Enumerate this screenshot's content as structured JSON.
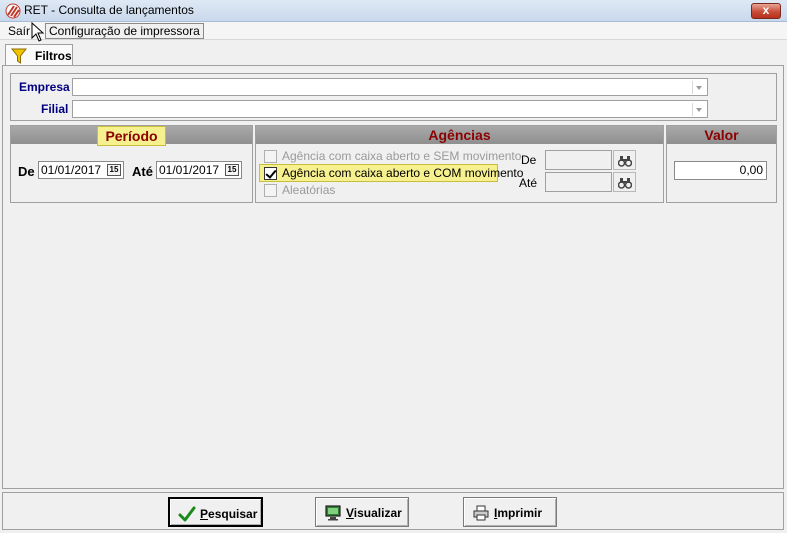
{
  "window": {
    "title": "RET - Consulta de lançamentos",
    "close_label": "x"
  },
  "menu": {
    "items": [
      "Saír",
      "Configuração de impressora"
    ]
  },
  "tabs": [
    {
      "label": "Filtros",
      "icon": "funnel-icon"
    }
  ],
  "filters": {
    "empresa_label": "Empresa",
    "empresa_value": "",
    "filial_label": "Filial",
    "filial_value": ""
  },
  "periodo": {
    "header": "Período",
    "de_label": "De",
    "de_value": "01/01/2017",
    "ate_label": "Até",
    "ate_value": "01/01/2017",
    "calendar_glyph": "15"
  },
  "agencias": {
    "header": "Agências",
    "options": [
      {
        "label": "Agência com caixa aberto e SEM movimento",
        "checked": false,
        "enabled": false
      },
      {
        "label": "Agência com caixa aberto e COM movimento",
        "checked": true,
        "enabled": true
      },
      {
        "label": "Aleatórias",
        "checked": false,
        "enabled": false
      }
    ],
    "de_label": "De",
    "de_value": "",
    "ate_label": "Até",
    "ate_value": ""
  },
  "valor": {
    "header": "Valor",
    "value": "0,00"
  },
  "buttons": {
    "pesquisar": "Pesquisar",
    "visualizar": "Visualizar",
    "imprimir": "Imprimir"
  },
  "colors": {
    "header_text": "#8b0000",
    "label_blue": "#000080",
    "highlight": "#f6f08e"
  }
}
